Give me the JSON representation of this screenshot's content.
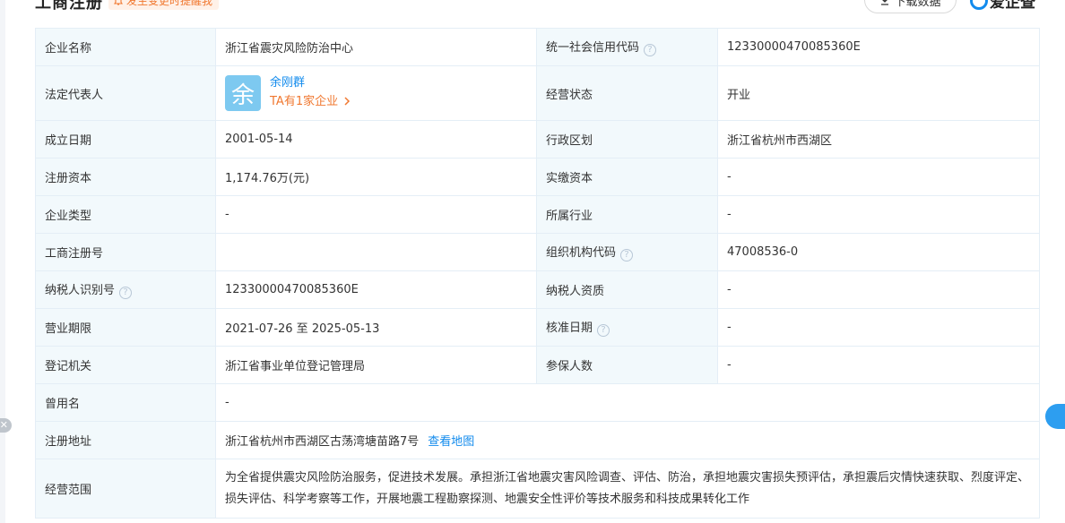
{
  "header": {
    "title": "工商注册",
    "alert_badge": "发生变更时提醒我",
    "download_button": "下载数据",
    "brand": "爱企查"
  },
  "table": {
    "company_name_label": "企业名称",
    "company_name": "浙江省震灾风险防治中心",
    "credit_code_label": "统一社会信用代码",
    "credit_code": "12330000470085360E",
    "legal_rep_label": "法定代表人",
    "legal_rep_avatar": "余",
    "legal_rep_name": "余刚群",
    "legal_rep_companies": "TA有1家企业",
    "status_label": "经营状态",
    "status": "开业",
    "founded_label": "成立日期",
    "founded": "2001-05-14",
    "region_label": "行政区划",
    "region": "浙江省杭州市西湖区",
    "capital_label": "注册资本",
    "capital": "1,174.76万(元)",
    "paid_capital_label": "实缴资本",
    "paid_capital": "-",
    "type_label": "企业类型",
    "type": "-",
    "industry_label": "所属行业",
    "industry": "-",
    "reg_no_label": "工商注册号",
    "reg_no": "",
    "org_code_label": "组织机构代码",
    "org_code": "47008536-0",
    "taxpayer_id_label": "纳税人识别号",
    "taxpayer_id": "12330000470085360E",
    "taxpayer_quality_label": "纳税人资质",
    "taxpayer_quality": "-",
    "term_label": "营业期限",
    "term": "2021-07-26 至 2025-05-13",
    "approval_date_label": "核准日期",
    "approval_date": "-",
    "authority_label": "登记机关",
    "authority": "浙江省事业单位登记管理局",
    "insured_label": "参保人数",
    "insured": "-",
    "former_name_label": "曾用名",
    "former_name": "-",
    "address_label": "注册地址",
    "address": "浙江省杭州市西湖区古荡湾塘苗路7号",
    "map_link": "查看地图",
    "scope_label": "经营范围",
    "scope": "为全省提供震灾风险防治服务，促进技术发展。承担浙江省地震灾害风险调查、评估、防治，承担地震灾害损失预评估，承担震后灾情快速获取、烈度评定、损失评估、科学考察等工作，开展地震工程勘察探测、地震安全性评价等技术服务和科技成果转化工作"
  },
  "help_glyph": "?",
  "colors": {
    "link_blue": "#128bed",
    "accent_orange": "#f07830",
    "label_bg": "#f2f9fc",
    "border": "#e4eef6",
    "avatar_bg": "#7dc9f0"
  },
  "icons": {
    "bell": "bell-icon",
    "download": "download-icon",
    "help": "question-circle-icon",
    "chevron": "chevron-right-icon"
  }
}
